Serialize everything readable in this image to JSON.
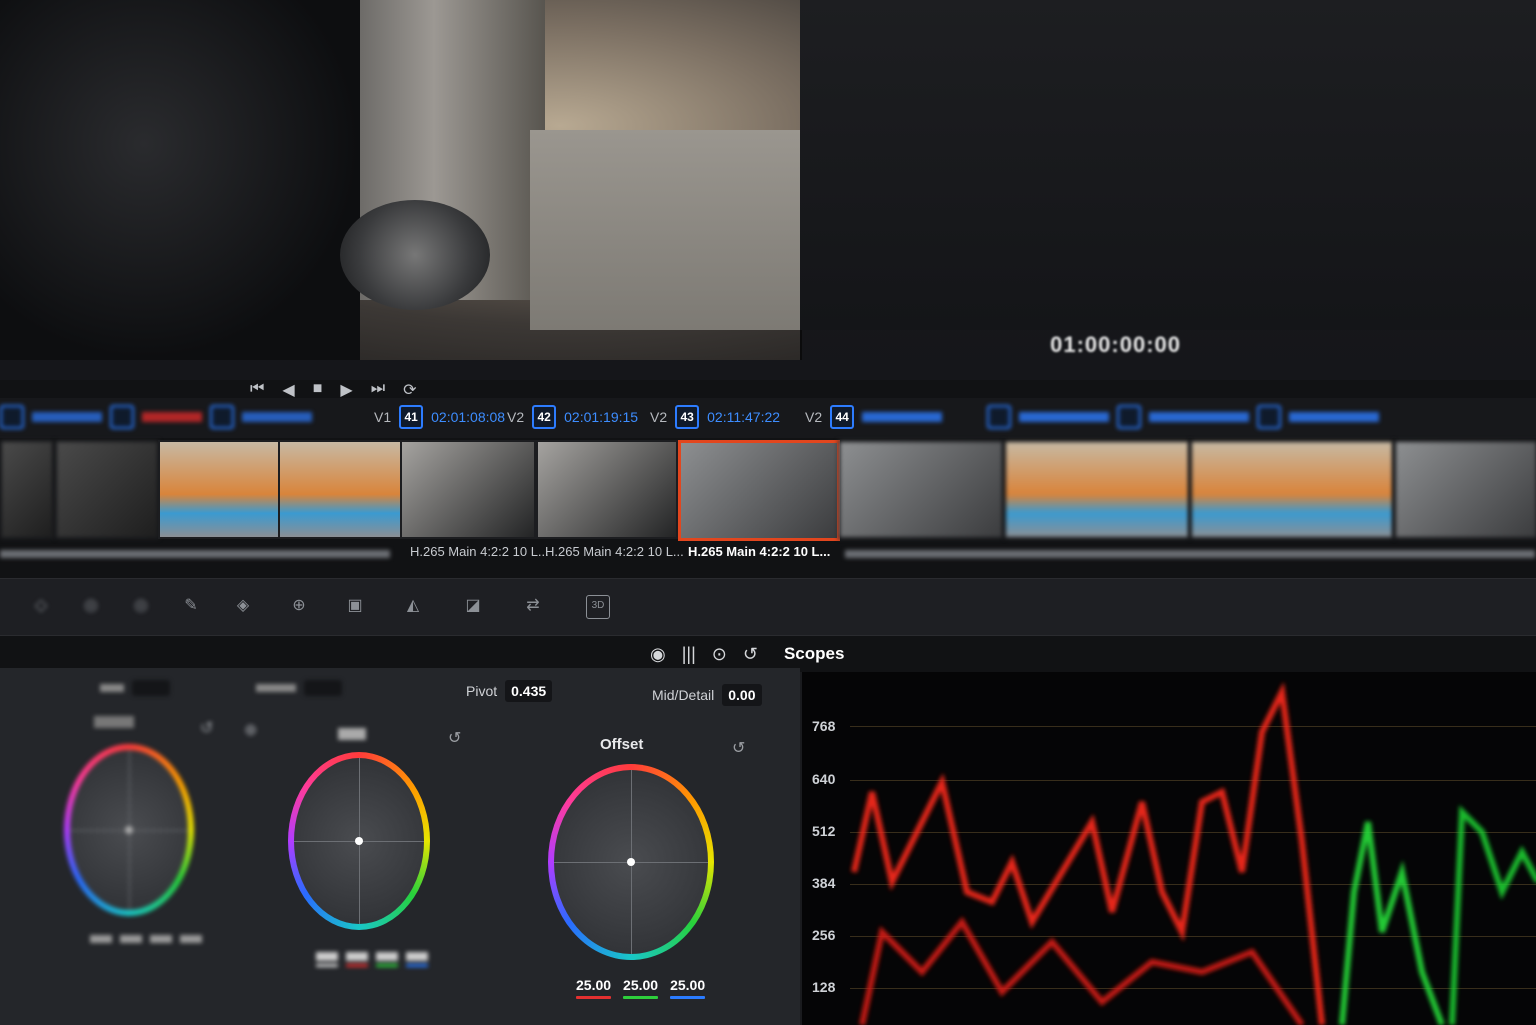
{
  "viewer": {
    "timecode": "01:00:00:00"
  },
  "transport": {
    "icons": [
      "skip-back-icon",
      "prev-icon",
      "stop-icon",
      "play-icon",
      "skip-forward-icon",
      "loop-icon"
    ]
  },
  "clips": [
    {
      "track": "V1",
      "number": "41",
      "timecode": "02:01:08:08"
    },
    {
      "track": "V2",
      "number": "42",
      "timecode": "02:01:19:15"
    },
    {
      "track": "V2",
      "number": "43",
      "timecode": "02:11:47:22"
    },
    {
      "track": "V2",
      "number": "44",
      "timecode": ""
    }
  ],
  "clip_labels": [
    "H.265 Main 4:2:2 10 L...",
    "H.265 Main 4:2:2 10 L...",
    "H.265 Main 4:2:2 10 L..."
  ],
  "scopes": {
    "title": "Scopes"
  },
  "params": {
    "pivot_label": "Pivot",
    "pivot_value": "0.435",
    "mid_label": "Mid/Detail",
    "mid_value": "0.00"
  },
  "wheels": {
    "offset": {
      "title": "Offset",
      "values": [
        "25.00",
        "25.00",
        "25.00"
      ]
    }
  },
  "scope_labels": [
    "768",
    "640",
    "512",
    "384",
    "256",
    "128"
  ],
  "colors": {
    "selection": "#e2461e",
    "accent": "#3d8dff"
  }
}
